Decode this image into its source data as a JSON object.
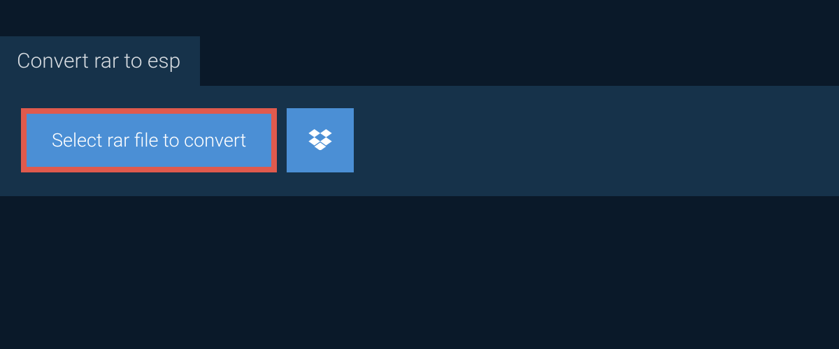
{
  "header": {
    "title": "Convert rar to esp"
  },
  "actions": {
    "select_file_label": "Select rar file to convert",
    "dropbox_icon": "dropbox-icon"
  },
  "colors": {
    "background": "#0a1929",
    "panel": "#16324a",
    "button": "#4b8fd5",
    "highlight_border": "#e05a4d",
    "text_light": "#d8dde2",
    "text_white": "#ffffff"
  }
}
